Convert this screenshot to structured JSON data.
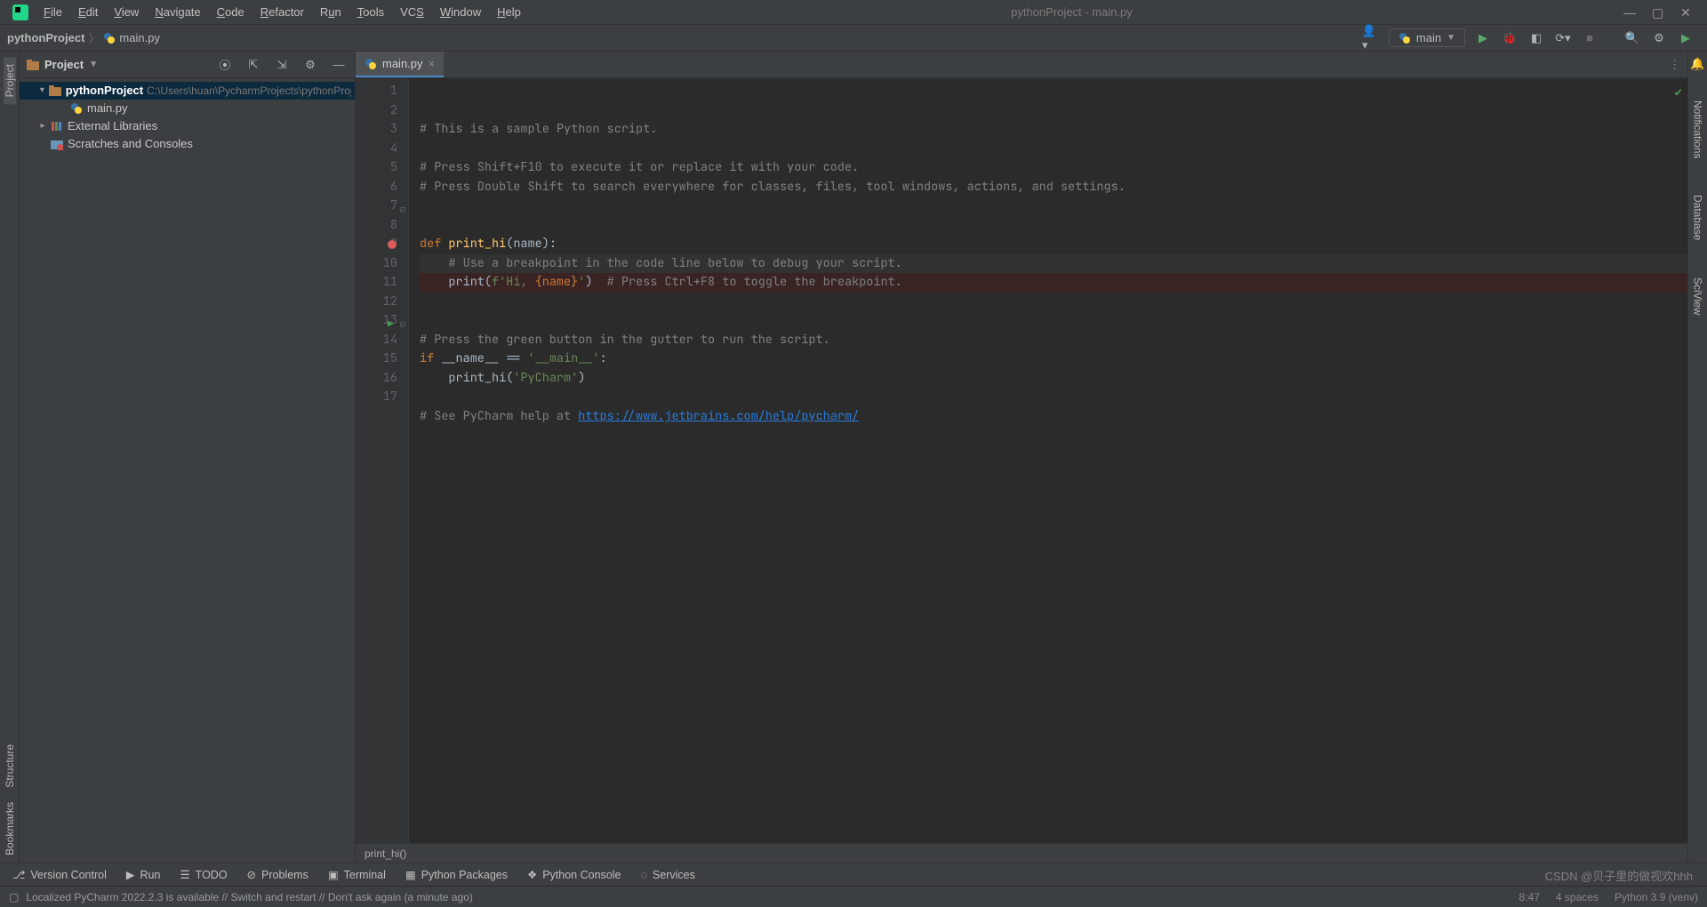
{
  "window": {
    "title": "pythonProject - main.py",
    "menus": [
      "File",
      "Edit",
      "View",
      "Navigate",
      "Code",
      "Refactor",
      "Run",
      "Tools",
      "VCS",
      "Window",
      "Help"
    ]
  },
  "breadcrumb": {
    "project": "pythonProject",
    "file": "main.py"
  },
  "runConfig": {
    "name": "main"
  },
  "projectPanel": {
    "title": "Project",
    "root": {
      "name": "pythonProject",
      "path": "C:\\Users\\huan\\PycharmProjects\\pythonProject"
    },
    "file": "main.py",
    "extLibs": "External Libraries",
    "scratches": "Scratches and Consoles"
  },
  "editorTab": {
    "name": "main.py"
  },
  "code": {
    "lines": [
      {
        "n": 1,
        "t": "comment",
        "text": "# This is a sample Python script."
      },
      {
        "n": 2,
        "t": "blank",
        "text": ""
      },
      {
        "n": 3,
        "t": "comment",
        "text": "# Press Shift+F10 to execute it or replace it with your code."
      },
      {
        "n": 4,
        "t": "comment",
        "text": "# Press Double Shift to search everywhere for classes, files, tool windows, actions, and settings."
      },
      {
        "n": 5,
        "t": "blank",
        "text": ""
      },
      {
        "n": 6,
        "t": "blank",
        "text": ""
      },
      {
        "n": 7,
        "t": "def",
        "kw": "def ",
        "fn": "print_hi",
        "rest": "(name):"
      },
      {
        "n": 8,
        "t": "comment_ind",
        "text": "# Use a breakpoint in the code line below to debug your script.",
        "cur": true
      },
      {
        "n": 9,
        "t": "print",
        "pre": "    ",
        "call": "print",
        "open": "(",
        "s1": "f'Hi, ",
        "br": "{name}",
        "s2": "'",
        "close": ")  ",
        "cmt": "# Press Ctrl+F8 to toggle the breakpoint.",
        "bp": true
      },
      {
        "n": 10,
        "t": "blank",
        "text": ""
      },
      {
        "n": 11,
        "t": "blank",
        "text": ""
      },
      {
        "n": 12,
        "t": "comment",
        "text": "# Press the green button in the gutter to run the script."
      },
      {
        "n": 13,
        "t": "ifmain",
        "kw": "if ",
        "id": "__name__",
        "op": " == ",
        "str": "'__main__'",
        "end": ":",
        "run": true
      },
      {
        "n": 14,
        "t": "callhi",
        "pre": "    ",
        "fn": "print_hi",
        "open": "(",
        "str": "'PyCharm'",
        "close": ")"
      },
      {
        "n": 15,
        "t": "blank",
        "text": ""
      },
      {
        "n": 16,
        "t": "seehelp",
        "cmt": "# See PyCharm help at ",
        "url": "https://www.jetbrains.com/help/pycharm/"
      },
      {
        "n": 17,
        "t": "blank",
        "text": ""
      }
    ],
    "breadcrumb": "print_hi()"
  },
  "toolWindows": [
    "Version Control",
    "Run",
    "TODO",
    "Problems",
    "Terminal",
    "Python Packages",
    "Python Console",
    "Services"
  ],
  "rightTabs": [
    "Notifications",
    "Database",
    "SciView"
  ],
  "leftTabs": {
    "top": [
      "Project"
    ],
    "bottom": [
      "Structure",
      "Bookmarks"
    ]
  },
  "status": {
    "msg": "Localized PyCharm 2022.2.3 is available // Switch and restart // Don't ask again (a minute ago)",
    "pos": "8:47",
    "indent": "4 spaces",
    "interp": "Python 3.9 (venv)"
  },
  "watermark": "CSDN @贝子里的做视欢hhh"
}
